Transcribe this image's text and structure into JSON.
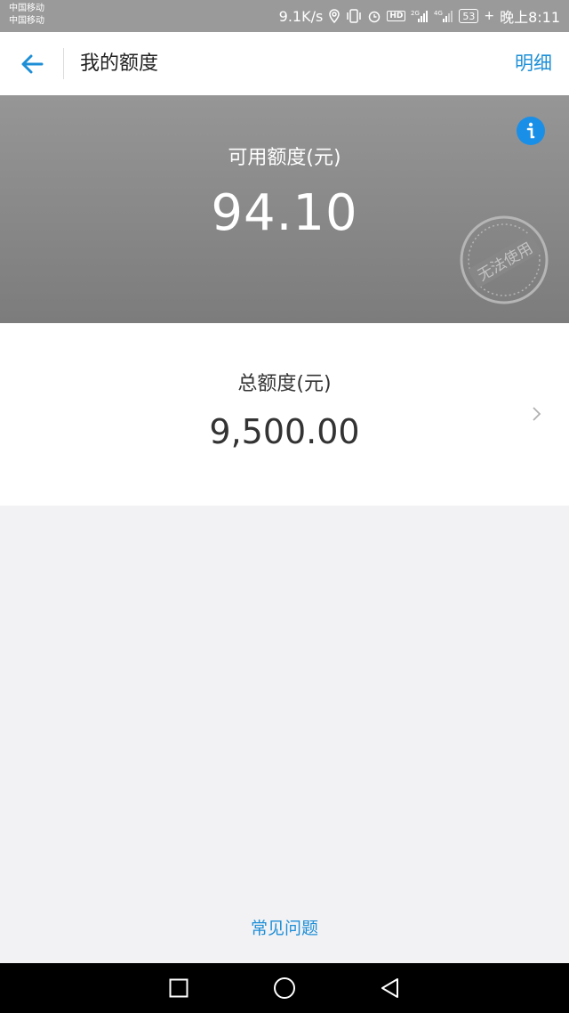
{
  "status_bar": {
    "carrier_1": "中国移动",
    "carrier_2": "中国移动",
    "net_speed": "9.1K/s",
    "hd_badge": "HD",
    "network_1": "2G",
    "network_2": "4G",
    "battery": "53",
    "time": "晚上8:11"
  },
  "navbar": {
    "title": "我的额度",
    "detail_link": "明细"
  },
  "available": {
    "label": "可用额度(元)",
    "value": "94.10",
    "stamp_text": "无法使用"
  },
  "total": {
    "label": "总额度(元)",
    "value": "9,500.00"
  },
  "faq_link": "常见问题",
  "colors": {
    "accent": "#1e8fd6",
    "info_badge": "#1a8fe8",
    "header_gray": "#888888"
  },
  "icons": {
    "back": "arrow-left-icon",
    "info": "info-icon",
    "chevron": "chevron-right-icon"
  }
}
